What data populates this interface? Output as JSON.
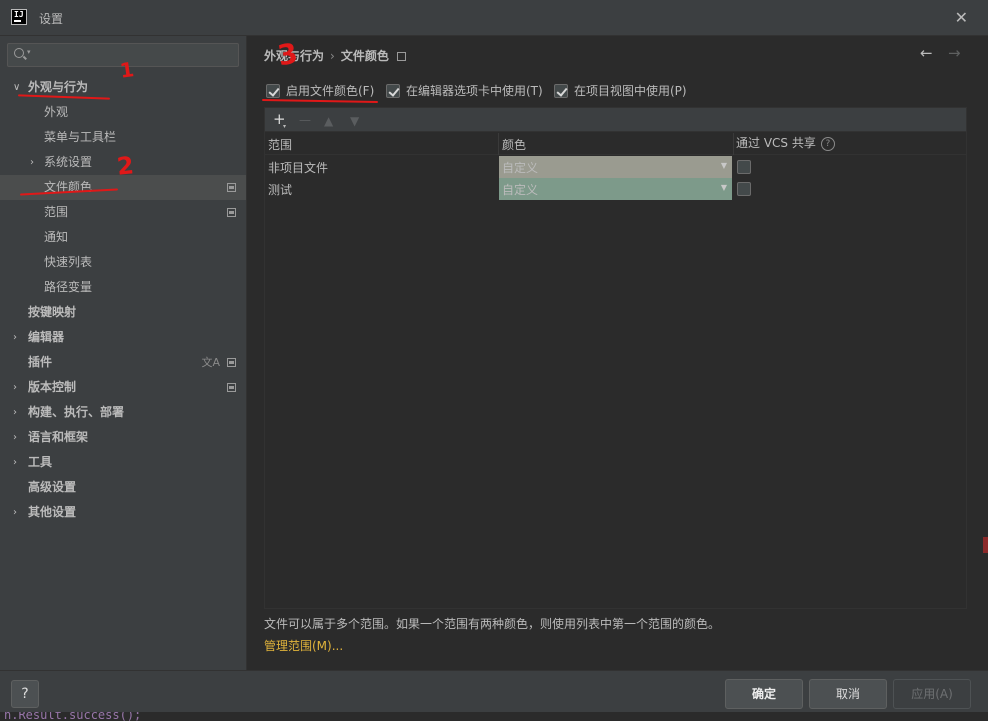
{
  "window": {
    "title": "设置",
    "app_logo": "IJ"
  },
  "search": {
    "placeholder": "",
    "value": ""
  },
  "sidebar": {
    "items": [
      {
        "label": "外观与行为",
        "expanded": true,
        "bold": true
      },
      {
        "label": "外观"
      },
      {
        "label": "菜单与工具栏"
      },
      {
        "label": "系统设置",
        "collapsed": true
      },
      {
        "label": "文件颜色",
        "selected": true
      },
      {
        "label": "范围"
      },
      {
        "label": "通知"
      },
      {
        "label": "快速列表"
      },
      {
        "label": "路径变量"
      },
      {
        "label": "按键映射"
      },
      {
        "label": "编辑器",
        "collapsed": true
      },
      {
        "label": "插件"
      },
      {
        "label": "版本控制",
        "collapsed": true
      },
      {
        "label": "构建、执行、部署",
        "collapsed": true
      },
      {
        "label": "语言和框架",
        "collapsed": true
      },
      {
        "label": "工具",
        "collapsed": true
      },
      {
        "label": "高级设置"
      },
      {
        "label": "其他设置",
        "collapsed": true
      }
    ]
  },
  "breadcrumb": {
    "parent": "外观与行为",
    "separator": "›",
    "current": "文件颜色"
  },
  "options": {
    "enable_file_colors": {
      "label": "启用文件颜色(F)",
      "checked": true
    },
    "use_in_editor_tabs": {
      "label": "在编辑器选项卡中使用(T)",
      "checked": true
    },
    "use_in_project_view": {
      "label": "在项目视图中使用(P)",
      "checked": true
    }
  },
  "table": {
    "columns": [
      "范围",
      "颜色",
      "通过 VCS 共享"
    ],
    "rows": [
      {
        "scope": "非项目文件",
        "color": "自定义",
        "color_hex": "#9a9b90",
        "shared": false
      },
      {
        "scope": "测试",
        "color": "自定义",
        "color_hex": "#7d9a8a",
        "shared": false
      }
    ]
  },
  "hint_text": "文件可以属于多个范围。如果一个范围有两种颜色，则使用列表中第一个范围的颜色。",
  "manage_scopes_link": "管理范围(M)...",
  "footer": {
    "help": "?",
    "ok": "确定",
    "cancel": "取消",
    "apply": "应用(A)"
  },
  "background_code": "n.Result.success();",
  "annotations": {
    "mark_1": "1",
    "mark_2": "2",
    "mark_3": "3"
  },
  "colors": {
    "accent_link": "#e0b33b",
    "annotation": "#e01818",
    "selection": "#4b4d4d",
    "sidebar_bg": "#3c3f41",
    "content_bg": "#2b2b2b"
  }
}
